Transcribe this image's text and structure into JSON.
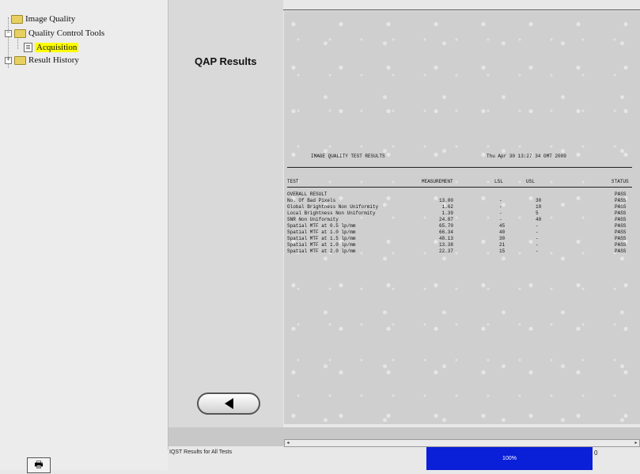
{
  "tree": {
    "items": [
      {
        "label": "Image Quality"
      },
      {
        "label": "Quality Control Tools"
      },
      {
        "label": "Acquisition"
      },
      {
        "label": "Result History"
      }
    ]
  },
  "panel": {
    "title": "QAP Results"
  },
  "report": {
    "heading": "IMAGE QUALITY TEST RESULTS",
    "datetime": "Thu Apr 30 13:27 34 GMT 2009",
    "columns": [
      "TEST",
      "MEASUREMENT",
      "LSL",
      "USL",
      "STATUS"
    ],
    "rows": [
      {
        "test": "OVERALL RESULT",
        "measurement": "",
        "lsl": "",
        "usl": "",
        "status": "PASS"
      },
      {
        "test": "No. Of Bad Pixels",
        "measurement": "13.00",
        "lsl": "-",
        "usl": "30",
        "status": "PASS"
      },
      {
        "test": "Global Brightness Non Uniformity",
        "measurement": "1.62",
        "lsl": "-",
        "usl": "10",
        "status": "PASS"
      },
      {
        "test": "Local Brightness Non Uniformity",
        "measurement": "1.39",
        "lsl": "-",
        "usl": "5",
        "status": "PASS"
      },
      {
        "test": "SNR Non Uniformity",
        "measurement": "24.87",
        "lsl": "-",
        "usl": "40",
        "status": "PASS"
      },
      {
        "test": "Spatial MTF at 0.5 lp/mm",
        "measurement": "65.70",
        "lsl": "45",
        "usl": "-",
        "status": "PASS"
      },
      {
        "test": "Spatial MTF at 1.0 lp/mm",
        "measurement": "66.34",
        "lsl": "40",
        "usl": "-",
        "status": "PASS"
      },
      {
        "test": "Spatial MTF at 1.5 lp/mm",
        "measurement": "48.13",
        "lsl": "30",
        "usl": "-",
        "status": "PASS"
      },
      {
        "test": "Spatial MTF at 1.0 lp/mm",
        "measurement": "13.38",
        "lsl": "21",
        "usl": "-",
        "status": "PASS"
      },
      {
        "test": "Spatial MTF at 2.0 lp/mm",
        "measurement": "22.37",
        "lsl": "15",
        "usl": "-",
        "status": "PASS"
      }
    ]
  },
  "status_bar": {
    "left_text": "IQST Results for All Tests",
    "progress_label": "100%",
    "progress_value": 1.0,
    "right_text": "0"
  },
  "icons": {
    "back": "left-triangle-icon",
    "print": "print-icon",
    "folder": "folder-icon"
  }
}
